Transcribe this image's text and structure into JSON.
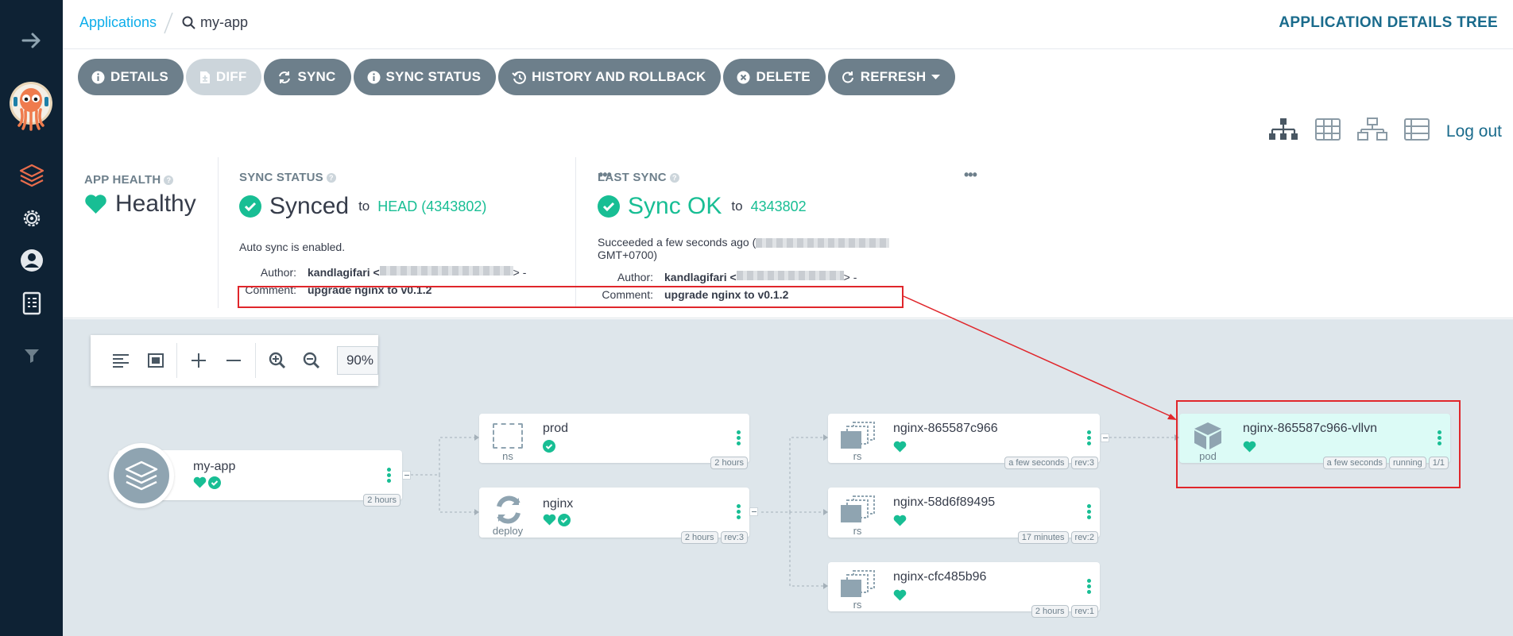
{
  "breadcrumb": {
    "root": "Applications",
    "current": "my-app"
  },
  "page_title": "APPLICATION DETAILS TREE",
  "toolbar": {
    "details": "DETAILS",
    "diff": "DIFF",
    "sync": "SYNC",
    "sync_status": "SYNC STATUS",
    "history": "HISTORY AND ROLLBACK",
    "delete": "DELETE",
    "refresh": "REFRESH"
  },
  "view": {
    "logout": "Log out"
  },
  "app_health": {
    "label": "APP HEALTH",
    "value": "Healthy"
  },
  "sync_status": {
    "label": "SYNC STATUS",
    "value": "Synced",
    "to": "to",
    "target": "HEAD (4343802)",
    "auto_sync": "Auto sync is enabled.",
    "author_label": "Author:",
    "author": "kandlagifari <",
    "author_tail": "> -",
    "comment_label": "Comment:",
    "comment": "upgrade nginx to v0.1.2"
  },
  "last_sync": {
    "label": "LAST SYNC",
    "value": "Sync OK",
    "to": "to",
    "target": "4343802",
    "succeeded": "Succeeded a few seconds ago (",
    "tz": "GMT+0700)",
    "author_label": "Author:",
    "author": "kandlagifari <",
    "author_tail": "> -",
    "comment_label": "Comment:",
    "comment": "upgrade nginx to v0.1.2"
  },
  "zoom": {
    "value": "90%"
  },
  "nodes": {
    "app": {
      "name": "my-app",
      "age": "2 hours"
    },
    "ns": {
      "name": "prod",
      "kind": "ns",
      "age": "2 hours"
    },
    "deploy": {
      "name": "nginx",
      "kind": "deploy",
      "age": "2 hours",
      "rev": "rev:3"
    },
    "rs1": {
      "name": "nginx-865587c966",
      "kind": "rs",
      "age": "a few seconds",
      "rev": "rev:3"
    },
    "rs2": {
      "name": "nginx-58d6f89495",
      "kind": "rs",
      "age": "17 minutes",
      "rev": "rev:2"
    },
    "rs3": {
      "name": "nginx-cfc485b96",
      "kind": "rs",
      "age": "2 hours",
      "rev": "rev:1"
    },
    "pod": {
      "name": "nginx-865587c966-vllvn",
      "kind": "pod",
      "age": "a few seconds",
      "status": "running",
      "ready": "1/1"
    }
  },
  "colors": {
    "sidebar": "#0e2234",
    "accent": "#18be94",
    "button": "#6d7f8b",
    "annotation": "#e0262b",
    "canvas": "#dee6eb"
  }
}
